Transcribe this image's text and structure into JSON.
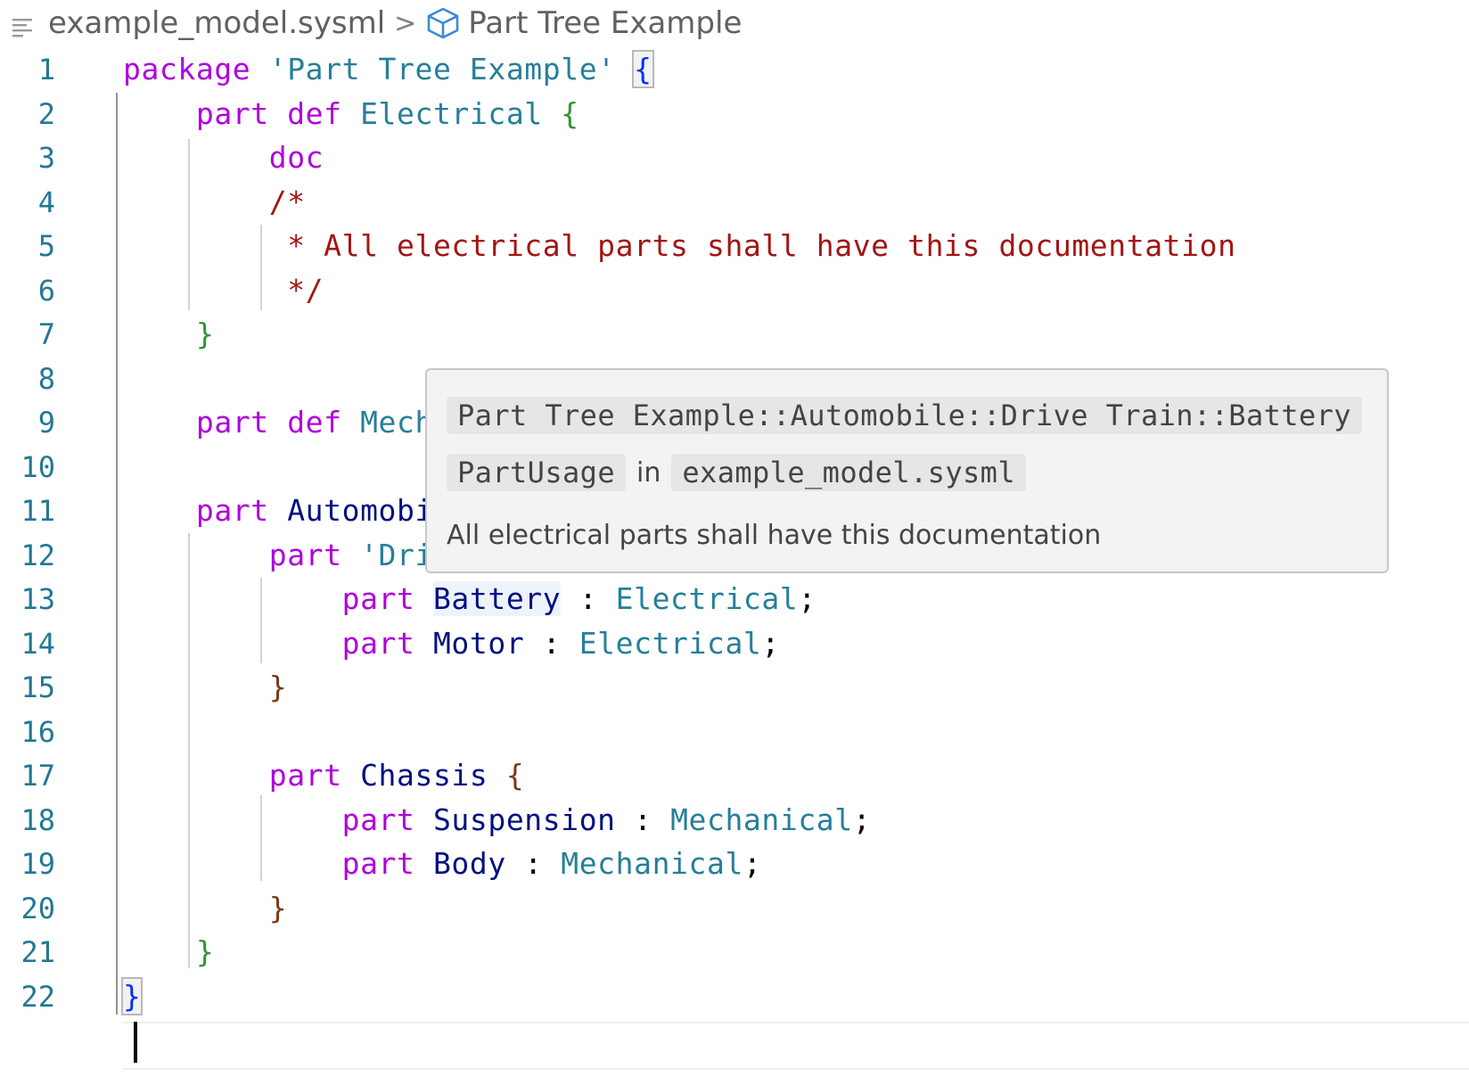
{
  "breadcrumb": {
    "file": "example_model.sysml",
    "separator": ">",
    "symbol": "Part Tree Example"
  },
  "editor": {
    "lines": [
      {
        "num": "1",
        "tokens": [
          [
            "kw",
            "package"
          ],
          [
            "p",
            " "
          ],
          [
            "str",
            "'Part Tree Example'"
          ],
          [
            "p",
            " "
          ],
          [
            "br1m",
            "{"
          ]
        ]
      },
      {
        "num": "2",
        "tokens": [
          [
            "p",
            "    "
          ],
          [
            "kw",
            "part"
          ],
          [
            "p",
            " "
          ],
          [
            "kw",
            "def"
          ],
          [
            "p",
            " "
          ],
          [
            "type",
            "Electrical"
          ],
          [
            "p",
            " "
          ],
          [
            "br2",
            "{"
          ]
        ]
      },
      {
        "num": "3",
        "tokens": [
          [
            "p",
            "        "
          ],
          [
            "kw",
            "doc"
          ]
        ]
      },
      {
        "num": "4",
        "tokens": [
          [
            "p",
            "        "
          ],
          [
            "cm",
            "/*"
          ]
        ]
      },
      {
        "num": "5",
        "tokens": [
          [
            "p",
            "         "
          ],
          [
            "cm",
            "* All electrical parts shall have this documentation"
          ]
        ]
      },
      {
        "num": "6",
        "tokens": [
          [
            "p",
            "         "
          ],
          [
            "cm",
            "*/"
          ]
        ]
      },
      {
        "num": "7",
        "tokens": [
          [
            "p",
            "    "
          ],
          [
            "br2",
            "}"
          ]
        ]
      },
      {
        "num": "8",
        "tokens": []
      },
      {
        "num": "9",
        "tokens": [
          [
            "p",
            "    "
          ],
          [
            "kw",
            "part"
          ],
          [
            "p",
            " "
          ],
          [
            "kw",
            "def"
          ],
          [
            "p",
            " "
          ],
          [
            "type",
            "Mech"
          ]
        ]
      },
      {
        "num": "10",
        "tokens": []
      },
      {
        "num": "11",
        "tokens": [
          [
            "p",
            "    "
          ],
          [
            "kw",
            "part"
          ],
          [
            "p",
            " "
          ],
          [
            "name",
            "Automobi"
          ]
        ]
      },
      {
        "num": "12",
        "tokens": [
          [
            "p",
            "        "
          ],
          [
            "kw",
            "part"
          ],
          [
            "p",
            " "
          ],
          [
            "str",
            "'Dri"
          ]
        ]
      },
      {
        "num": "13",
        "tokens": [
          [
            "p",
            "            "
          ],
          [
            "kw",
            "part"
          ],
          [
            "p",
            " "
          ],
          [
            "nameh",
            "Battery"
          ],
          [
            "p",
            " : "
          ],
          [
            "type",
            "Electrical"
          ],
          [
            "p",
            ";"
          ]
        ]
      },
      {
        "num": "14",
        "tokens": [
          [
            "p",
            "            "
          ],
          [
            "kw",
            "part"
          ],
          [
            "p",
            " "
          ],
          [
            "name",
            "Motor"
          ],
          [
            "p",
            " : "
          ],
          [
            "type",
            "Electrical"
          ],
          [
            "p",
            ";"
          ]
        ]
      },
      {
        "num": "15",
        "tokens": [
          [
            "p",
            "        "
          ],
          [
            "br3",
            "}"
          ]
        ]
      },
      {
        "num": "16",
        "tokens": []
      },
      {
        "num": "17",
        "tokens": [
          [
            "p",
            "        "
          ],
          [
            "kw",
            "part"
          ],
          [
            "p",
            " "
          ],
          [
            "name",
            "Chassis"
          ],
          [
            "p",
            " "
          ],
          [
            "br3",
            "{"
          ]
        ]
      },
      {
        "num": "18",
        "tokens": [
          [
            "p",
            "            "
          ],
          [
            "kw",
            "part"
          ],
          [
            "p",
            " "
          ],
          [
            "name",
            "Suspension"
          ],
          [
            "p",
            " : "
          ],
          [
            "type",
            "Mechanical"
          ],
          [
            "p",
            ";"
          ]
        ]
      },
      {
        "num": "19",
        "tokens": [
          [
            "p",
            "            "
          ],
          [
            "kw",
            "part"
          ],
          [
            "p",
            " "
          ],
          [
            "name",
            "Body"
          ],
          [
            "p",
            " : "
          ],
          [
            "type",
            "Mechanical"
          ],
          [
            "p",
            ";"
          ]
        ]
      },
      {
        "num": "20",
        "tokens": [
          [
            "p",
            "        "
          ],
          [
            "br3",
            "}"
          ]
        ]
      },
      {
        "num": "21",
        "tokens": [
          [
            "p",
            "    "
          ],
          [
            "br2",
            "}"
          ]
        ]
      },
      {
        "num": "22",
        "tokens": [
          [
            "br1m",
            "}"
          ]
        ]
      }
    ]
  },
  "hover": {
    "qualified_name": "Part Tree Example::Automobile::Drive Train::Battery",
    "kind": "PartUsage",
    "in_label": "in",
    "file": "example_model.sysml",
    "doc": "All electrical parts shall have this documentation"
  },
  "colors": {
    "keyword": "#af00db",
    "type": "#267f99",
    "identifier": "#001080",
    "comment": "#a31515",
    "line_number": "#237893"
  },
  "icons": {
    "outline": "lines-icon",
    "symbol": "cube-icon"
  }
}
